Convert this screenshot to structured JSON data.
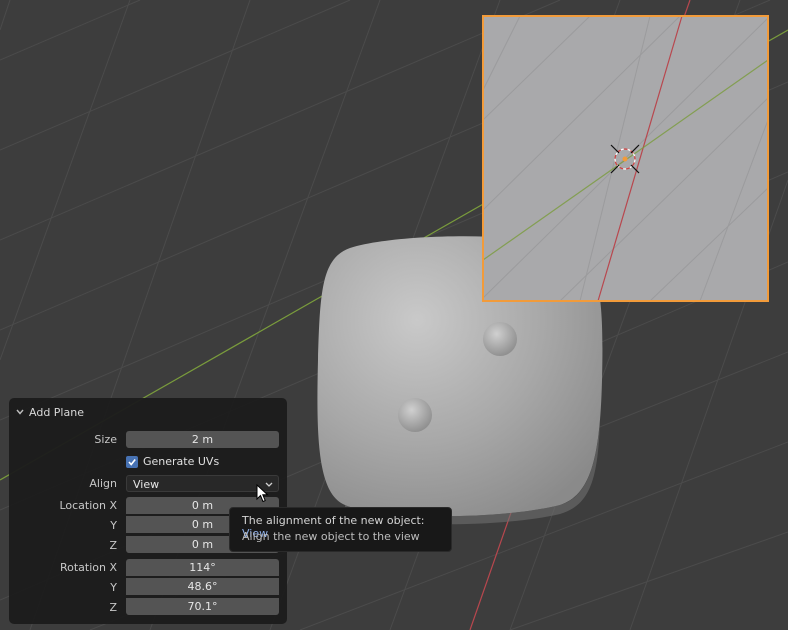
{
  "panel": {
    "title": "Add Plane",
    "size_label": "Size",
    "size_value": "2 m",
    "generate_uvs_label": "Generate UVs",
    "generate_uvs_checked": true,
    "align_label": "Align",
    "align_value": "View",
    "location_x_label": "Location X",
    "location_x_value": "0 m",
    "location_y_label": "Y",
    "location_y_value": "0 m",
    "location_z_label": "Z",
    "location_z_value": "0 m",
    "rotation_x_label": "Rotation X",
    "rotation_x_value": "114°",
    "rotation_y_label": "Y",
    "rotation_y_value": "48.6°",
    "rotation_z_label": "Z",
    "rotation_z_value": "70.1°"
  },
  "tooltip": {
    "line1_prefix": "The alignment of the new object:",
    "line1_value": "View",
    "line2": "Align the new object to the view"
  },
  "colors": {
    "viewport_bg": "#3d3d3d",
    "selection_outline": "#f29b3a",
    "x_axis": "#b8474e",
    "y_axis": "#7a9c3c",
    "accent": "#4772b3"
  }
}
